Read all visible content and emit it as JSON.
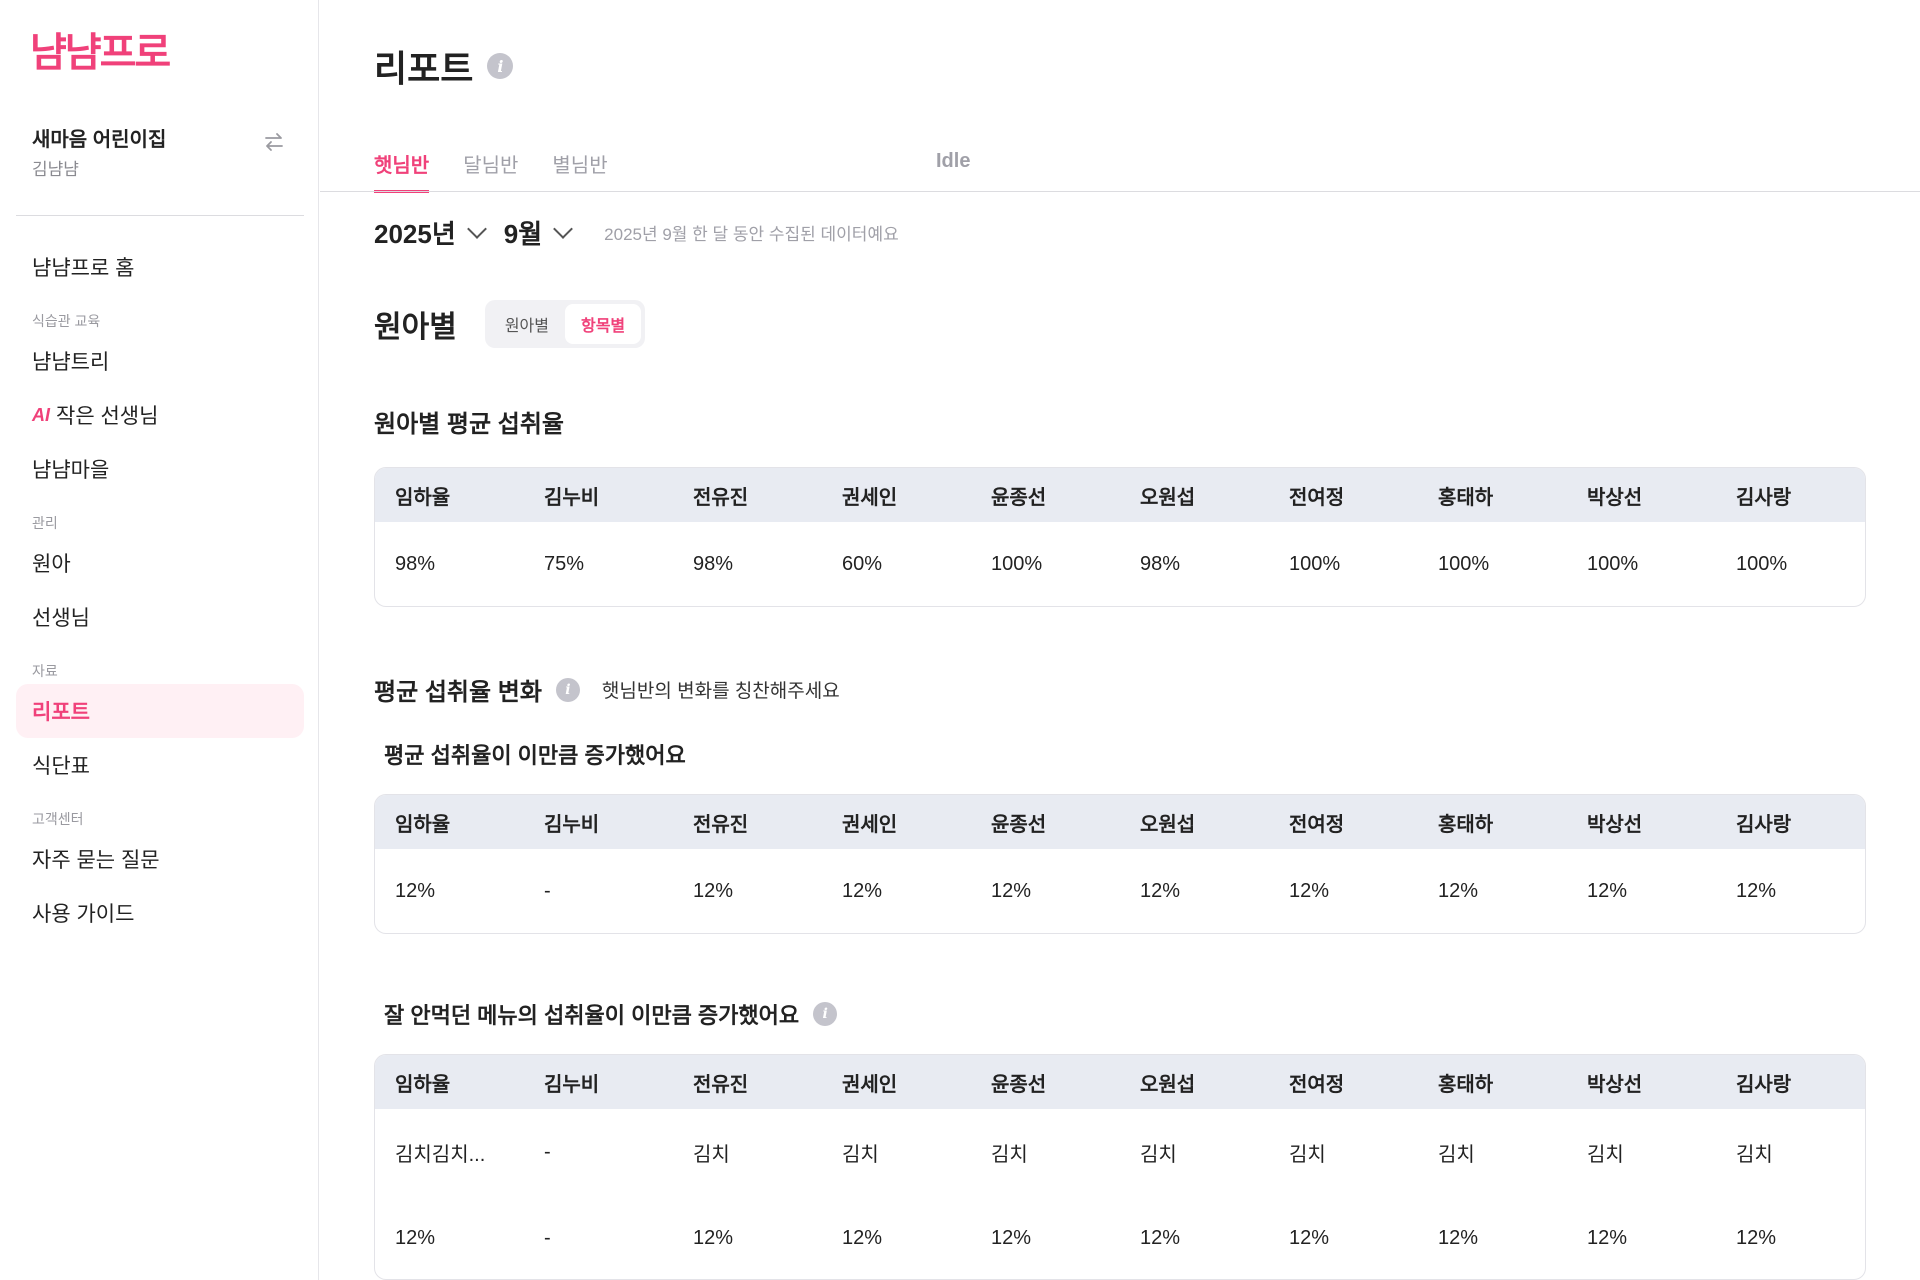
{
  "brand": {
    "logo": "냠냠프로",
    "accent": "#f0417a"
  },
  "org": {
    "name": "새마음 어린이집",
    "user": "김냠냠"
  },
  "nav": {
    "home": "냠냠프로 홈",
    "section_habit": "식습관 교육",
    "item_tree": "냠냠트리",
    "ai_badge": "AI",
    "item_ai_teacher": "작은 선생님",
    "item_village": "냠냠마을",
    "section_manage": "관리",
    "item_kids": "원아",
    "item_teachers": "선생님",
    "section_data": "자료",
    "item_report": "리포트",
    "item_menu": "식단표",
    "section_support": "고객센터",
    "item_faq": "자주 묻는 질문",
    "item_guide": "사용 가이드"
  },
  "page": {
    "title": "리포트"
  },
  "tabs": [
    "햇님반",
    "달님반",
    "별님반"
  ],
  "tab_idle": "Idle",
  "period": {
    "year": "2025년",
    "month": "9월",
    "note": "2025년 9월 한 달 동안 수집된 데이터예요"
  },
  "section": {
    "title": "원아별",
    "toggle_by_child": "원아별",
    "toggle_by_item": "항목별"
  },
  "avg_intake": {
    "title": "원아별 평균 섭취율",
    "headers": [
      "임하율",
      "김누비",
      "전유진",
      "권세인",
      "윤종선",
      "오원섭",
      "전여정",
      "홍태하",
      "박상선",
      "김사랑"
    ],
    "values": [
      "98%",
      "75%",
      "98%",
      "60%",
      "100%",
      "98%",
      "100%",
      "100%",
      "100%",
      "100%"
    ]
  },
  "change": {
    "title": "평균 섭취율 변화",
    "praise": "햇님반의 변화를 칭찬해주세요",
    "increase_title": "평균 섭취율이 이만큼 증가했어요",
    "headers": [
      "임하율",
      "김누비",
      "전유진",
      "권세인",
      "윤종선",
      "오원섭",
      "전여정",
      "홍태하",
      "박상선",
      "김사랑"
    ],
    "values": [
      "12%",
      "-",
      "12%",
      "12%",
      "12%",
      "12%",
      "12%",
      "12%",
      "12%",
      "12%"
    ]
  },
  "disliked": {
    "title": "잘 안먹던 메뉴의 섭취율이 이만큼 증가했어요",
    "headers": [
      "임하율",
      "김누비",
      "전유진",
      "권세인",
      "윤종선",
      "오원섭",
      "전여정",
      "홍태하",
      "박상선",
      "김사랑"
    ],
    "menus": [
      "김치김치...",
      "-",
      "김치",
      "김치",
      "김치",
      "김치",
      "김치",
      "김치",
      "김치",
      "김치"
    ],
    "values": [
      "12%",
      "-",
      "12%",
      "12%",
      "12%",
      "12%",
      "12%",
      "12%",
      "12%",
      "12%"
    ]
  }
}
